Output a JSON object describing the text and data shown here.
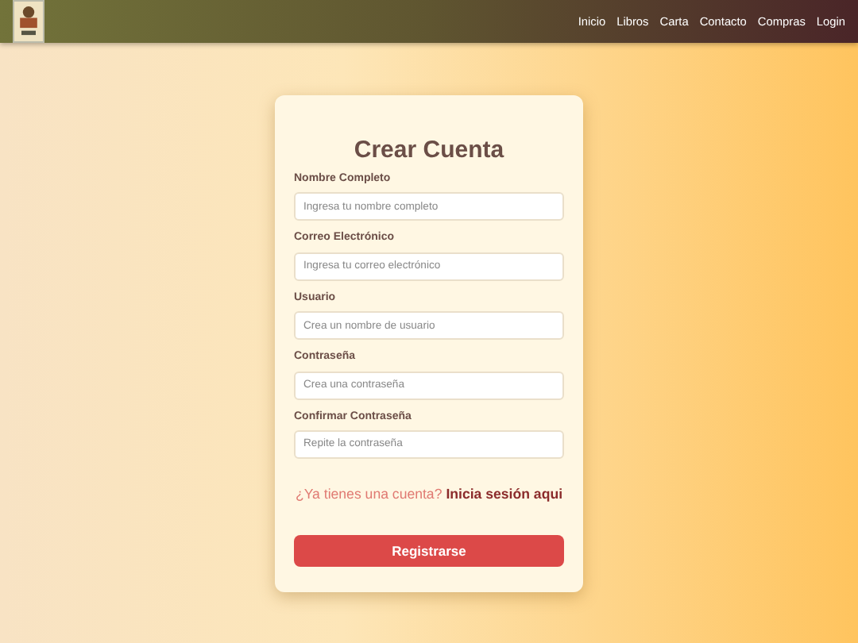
{
  "nav": {
    "links": [
      "Inicio",
      "Libros",
      "Carta",
      "Contacto",
      "Compras",
      "Login"
    ]
  },
  "form": {
    "title": "Crear Cuenta",
    "fields": [
      {
        "label": "Nombre Completo",
        "placeholder": "Ingresa tu nombre completo"
      },
      {
        "label": "Correo Electrónico",
        "placeholder": "Ingresa tu correo electrónico"
      },
      {
        "label": "Usuario",
        "placeholder": "Crea un nombre de usuario"
      },
      {
        "label": "Contraseña",
        "placeholder": "Crea una contraseña"
      },
      {
        "label": "Confirmar Contraseña",
        "placeholder": "Repite la contraseña"
      }
    ],
    "login_prompt": "¿Ya tienes una cuenta?",
    "login_link": "Inicia sesión aqui",
    "submit": "Registrarse"
  }
}
